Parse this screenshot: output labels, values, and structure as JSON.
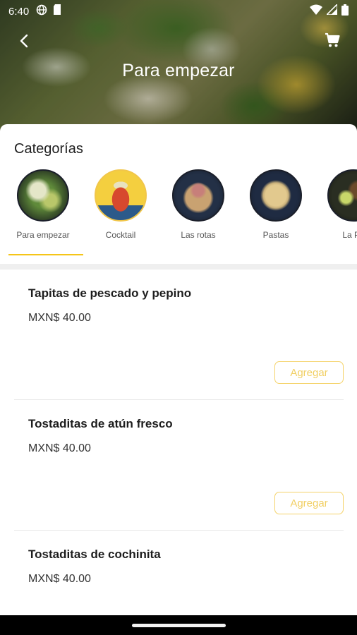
{
  "status_bar": {
    "time": "6:40",
    "left_icons": [
      "globe-icon",
      "sim-card-icon"
    ],
    "right_icons": [
      "wifi-icon",
      "signal-icon",
      "battery-icon"
    ]
  },
  "header": {
    "title": "Para empezar",
    "back_icon": "back-arrow-icon",
    "cart_icon": "cart-icon"
  },
  "categories": {
    "title": "Categorías",
    "active_color": "#f5c518",
    "items": [
      {
        "label": "Para empezar",
        "active": true
      },
      {
        "label": "Cocktail",
        "active": false
      },
      {
        "label": "Las rotas",
        "active": false
      },
      {
        "label": "Pastas",
        "active": false
      },
      {
        "label": "La Pe",
        "active": false
      }
    ]
  },
  "menu_items": [
    {
      "name": "Tapitas de pescado y pepino",
      "price": "MXN$ 40.00",
      "add_label": "Agregar"
    },
    {
      "name": "Tostaditas de atún fresco",
      "price": "MXN$ 40.00",
      "add_label": "Agregar"
    },
    {
      "name": "Tostaditas de cochinita",
      "price": "MXN$ 40.00",
      "add_label": "Agregar"
    }
  ],
  "colors": {
    "accent": "#f5c518",
    "button_border": "#f5d36a",
    "button_text": "#f1cf63"
  }
}
